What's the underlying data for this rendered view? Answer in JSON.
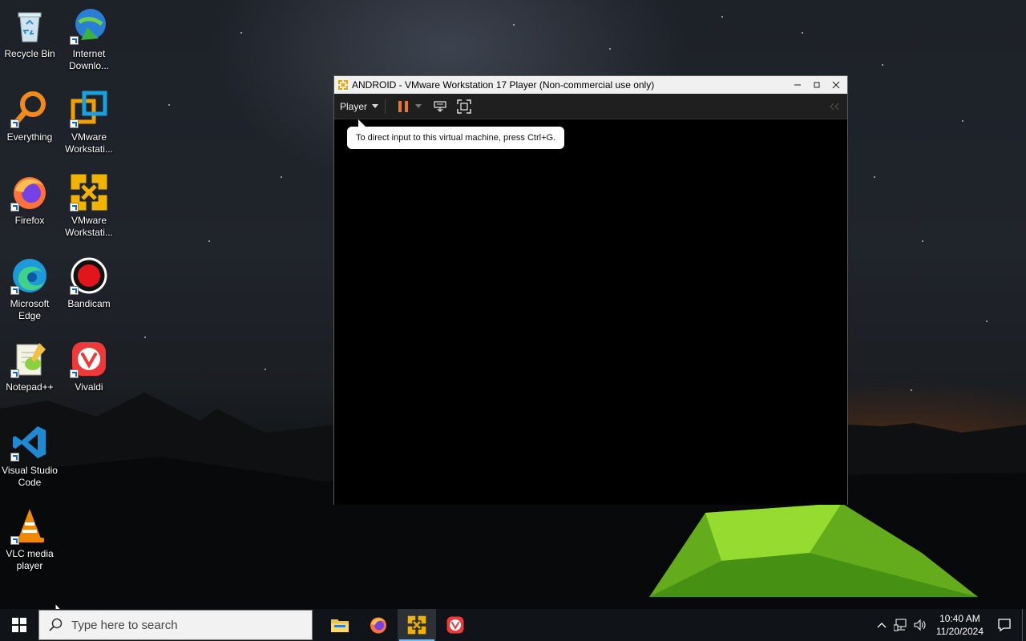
{
  "desktop": {
    "icons": [
      {
        "label": "Recycle Bin",
        "icon": "recycle-bin-icon"
      },
      {
        "label": "Internet Downlo...",
        "icon": "internet-download-manager-icon"
      },
      {
        "label": "Everything",
        "icon": "everything-search-icon"
      },
      {
        "label": "VMware Workstati...",
        "icon": "vmware-workstation-icon"
      },
      {
        "label": "Firefox",
        "icon": "firefox-icon"
      },
      {
        "label": "VMware Workstati...",
        "icon": "vmware-player-icon"
      },
      {
        "label": "Microsoft Edge",
        "icon": "edge-icon"
      },
      {
        "label": "Bandicam",
        "icon": "bandicam-icon"
      },
      {
        "label": "Notepad++",
        "icon": "notepad-plus-plus-icon"
      },
      {
        "label": "Vivaldi",
        "icon": "vivaldi-icon"
      },
      {
        "label": "Visual Studio Code",
        "icon": "vscode-icon"
      },
      {
        "label": "VLC media player",
        "icon": "vlc-icon"
      }
    ]
  },
  "window": {
    "title": "ANDROID - VMware Workstation 17 Player (Non-commercial use only)",
    "menu_label": "Player",
    "tooltip": "To direct input to this virtual machine, press Ctrl+G."
  },
  "taskbar": {
    "search_placeholder": "Type here to search",
    "time": "10:40 AM",
    "date": "11/20/2024",
    "apps": [
      "file-explorer-icon",
      "firefox-icon",
      "vmware-player-icon",
      "vivaldi-icon"
    ]
  },
  "colors": {
    "taskbar_bg": "#101418",
    "active_indicator": "#76b9ed",
    "vmware_orange": "#f0a000",
    "pause_orange": "#e8762c"
  }
}
